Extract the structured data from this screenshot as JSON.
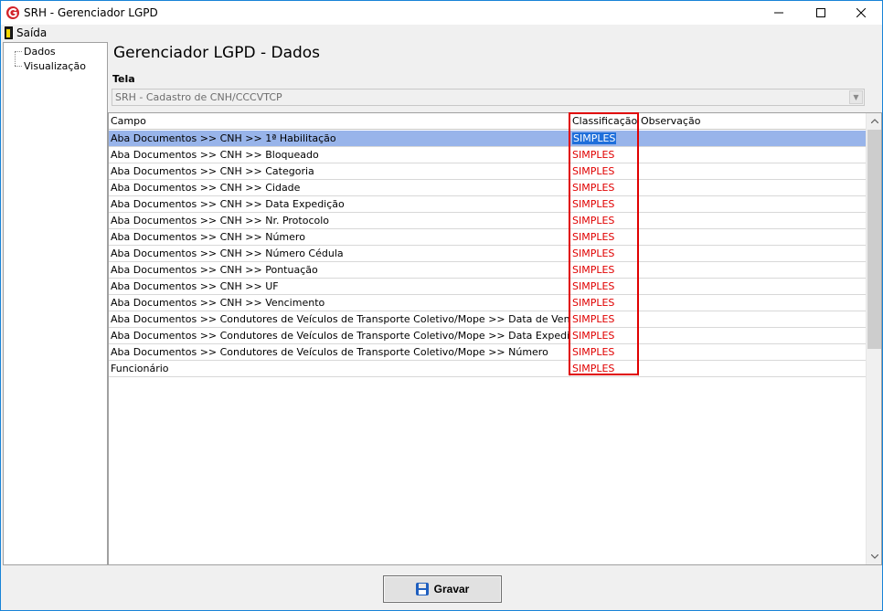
{
  "window": {
    "title": "SRH - Gerenciador LGPD",
    "controls": {
      "minimize": "–",
      "maximize": "☐",
      "close": "✕"
    }
  },
  "menu": {
    "exit_label": "Saída"
  },
  "tree": {
    "items": [
      {
        "label": "Dados"
      },
      {
        "label": "Visualização"
      }
    ]
  },
  "main": {
    "title": "Gerenciador LGPD - Dados",
    "screen_label": "Tela",
    "screen_select_value": "SRH - Cadastro de CNH/CCCVTCP"
  },
  "grid": {
    "headers": {
      "campo": "Campo",
      "classificacao": "Classificação",
      "observacao": "Observação"
    },
    "rows": [
      {
        "campo": "Aba Documentos >> CNH >> 1ª Habilitação",
        "classificacao": "SIMPLES",
        "observacao": ""
      },
      {
        "campo": "Aba Documentos >> CNH >> Bloqueado",
        "classificacao": "SIMPLES",
        "observacao": ""
      },
      {
        "campo": "Aba Documentos >> CNH >> Categoria",
        "classificacao": "SIMPLES",
        "observacao": ""
      },
      {
        "campo": "Aba Documentos >> CNH >> Cidade",
        "classificacao": "SIMPLES",
        "observacao": ""
      },
      {
        "campo": "Aba Documentos >> CNH >> Data Expedição",
        "classificacao": "SIMPLES",
        "observacao": ""
      },
      {
        "campo": "Aba Documentos >> CNH >> Nr. Protocolo",
        "classificacao": "SIMPLES",
        "observacao": ""
      },
      {
        "campo": "Aba Documentos >> CNH >> Número",
        "classificacao": "SIMPLES",
        "observacao": ""
      },
      {
        "campo": "Aba Documentos >> CNH >> Número Cédula",
        "classificacao": "SIMPLES",
        "observacao": ""
      },
      {
        "campo": "Aba Documentos >> CNH >> Pontuação",
        "classificacao": "SIMPLES",
        "observacao": ""
      },
      {
        "campo": "Aba Documentos >> CNH >> UF",
        "classificacao": "SIMPLES",
        "observacao": ""
      },
      {
        "campo": "Aba Documentos >> CNH >> Vencimento",
        "classificacao": "SIMPLES",
        "observacao": ""
      },
      {
        "campo": "Aba Documentos >> Condutores de Veículos de Transporte Coletivo/Mope >> Data de Vencimento",
        "classificacao": "SIMPLES",
        "observacao": ""
      },
      {
        "campo": "Aba Documentos >> Condutores de Veículos de Transporte Coletivo/Mope >> Data Expedição",
        "classificacao": "SIMPLES",
        "observacao": ""
      },
      {
        "campo": "Aba Documentos >> Condutores de Veículos de Transporte Coletivo/Mope >> Número",
        "classificacao": "SIMPLES",
        "observacao": ""
      },
      {
        "campo": "Funcionário",
        "classificacao": "SIMPLES",
        "observacao": ""
      }
    ]
  },
  "actions": {
    "save_label": "Gravar"
  },
  "colors": {
    "selected_row": "#98b4ea",
    "classification_text": "#e00000",
    "highlight_border": "#e00000",
    "title_bar_border": "#1883d7"
  }
}
